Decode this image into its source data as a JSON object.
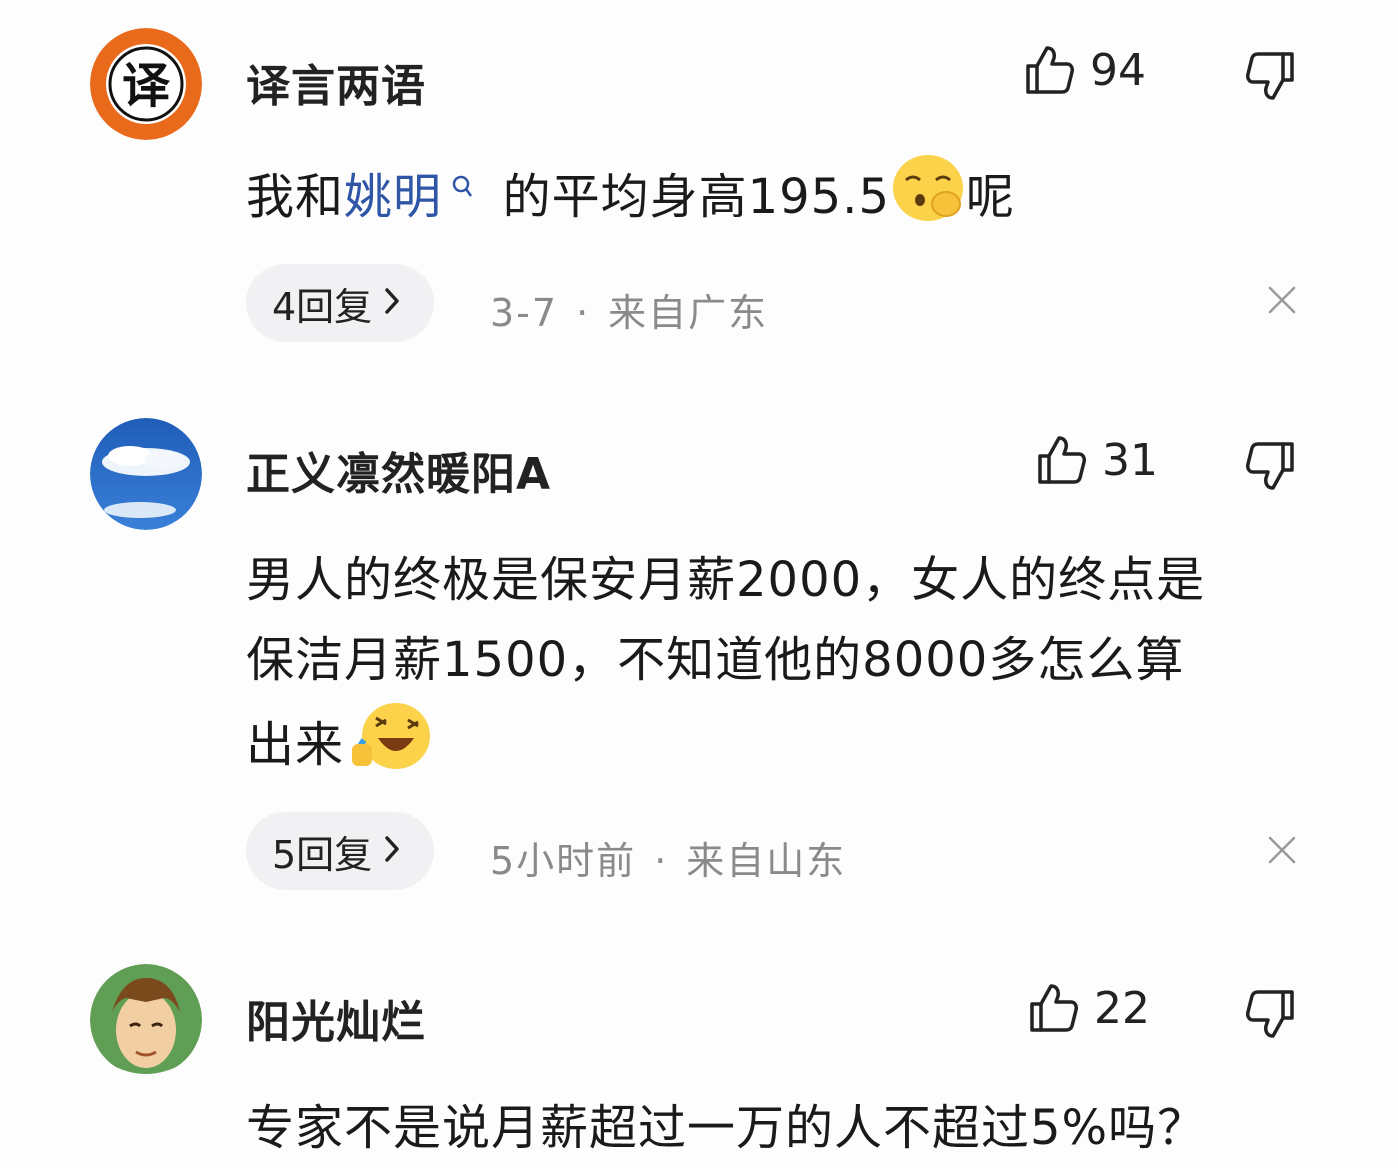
{
  "comments": [
    {
      "username": "译言两语",
      "avatar_glyph": "译",
      "likes": "94",
      "text_before": "我和",
      "text_link": "姚明",
      "text_after": "的平均身高195.5",
      "text_end": "呢",
      "emoji": "shushing-face-emoji",
      "reply_label": "4回复",
      "date": "3-7",
      "location": "来自广东"
    },
    {
      "username": "正义凛然暖阳A",
      "likes": "31",
      "text_line1": "男人的终极是保安月薪2000，女人的终点是",
      "text_line2": "保洁月薪1500，不知道他的8000多怎么算",
      "text_line3": "出来",
      "emoji": "laughing-crying-emoji",
      "reply_label": "5回复",
      "date": "5小时前",
      "location": "来自山东"
    },
    {
      "username": "阳光灿烂",
      "likes": "22",
      "text": "专家不是说月薪超过一万的人不超过5%吗？"
    }
  ],
  "meta_separator": "·",
  "icons": [
    "thumbs-up-icon",
    "thumbs-down-icon",
    "chevron-right-icon",
    "close-icon",
    "search-icon"
  ],
  "colors": {
    "link": "#2f56a6",
    "meta": "#8a8a8a",
    "reply_bg": "#f1f1f3",
    "avatar1": "#ea6a1c"
  }
}
